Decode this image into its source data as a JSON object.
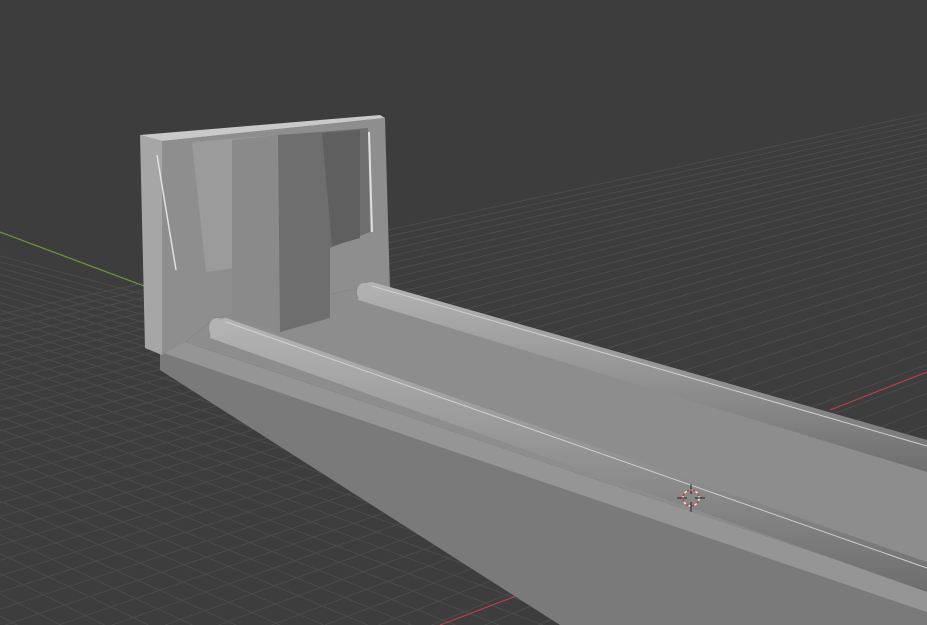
{
  "viewport": {
    "type": "3d-viewport",
    "background_color": "#3d3d3d",
    "grid_color": "#4b4b4b",
    "x_axis_color": "#b8404c",
    "y_axis_color": "#6f9a3a",
    "object_color": "#8c8c8c",
    "cursor_icon": "3d-cursor-icon"
  }
}
